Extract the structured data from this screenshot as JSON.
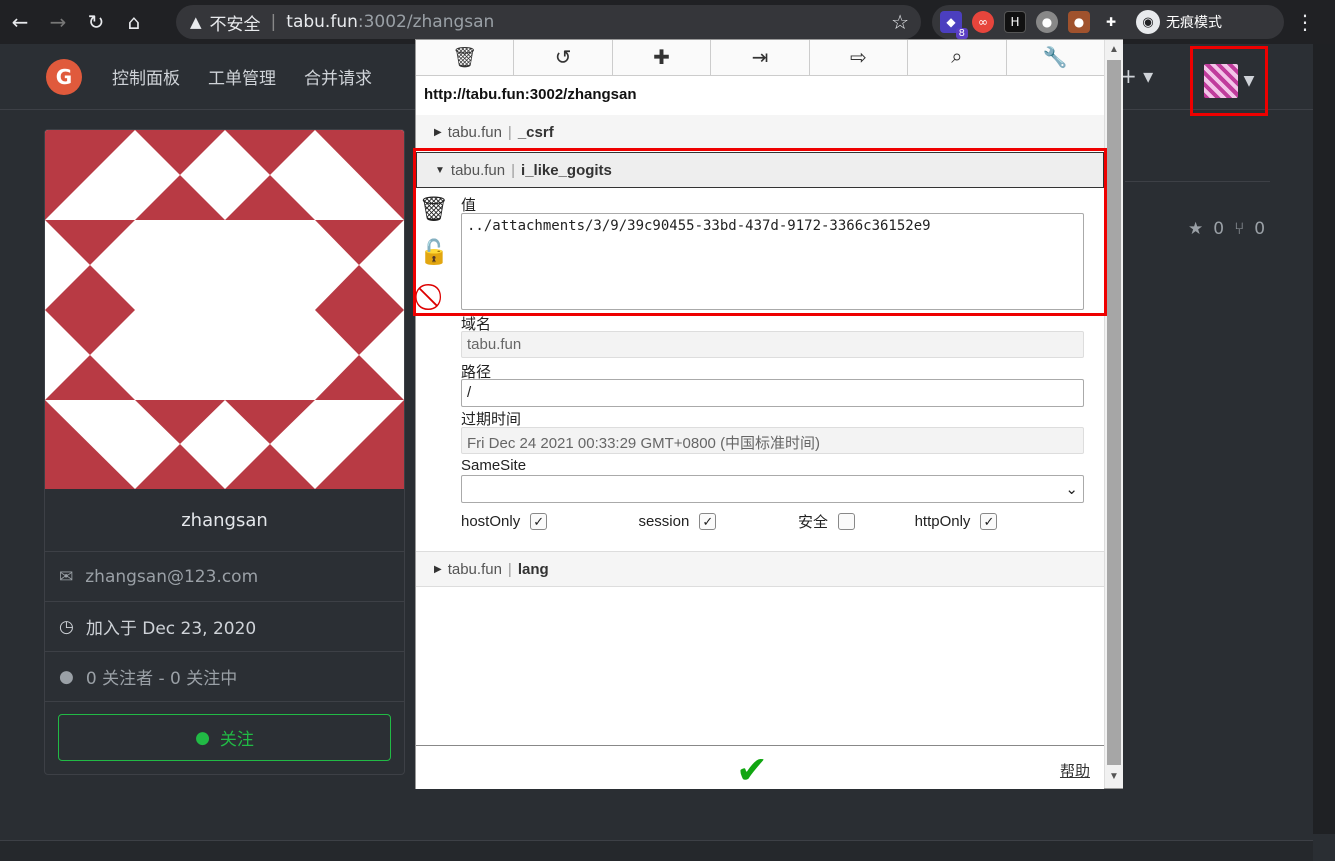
{
  "browser": {
    "address_warning": "不安全",
    "url_host": "tabu.fun",
    "url_rest": ":3002/zhangsan",
    "ext_badge": "8",
    "incognito_label": "无痕模式"
  },
  "site": {
    "nav": [
      "控制面板",
      "工单管理",
      "合并请求"
    ],
    "plus": "+"
  },
  "profile": {
    "username": "zhangsan",
    "email": "zhangsan@123.com",
    "joined": "加入于 Dec 23, 2020",
    "followers": "0 关注者 - 0 关注中",
    "follow_button": "关注",
    "stars": "0",
    "forks": "0"
  },
  "cookie_editor": {
    "url": "http://tabu.fun:3002/zhangsan",
    "cookies": [
      {
        "domain": "tabu.fun",
        "name": "_csrf"
      },
      {
        "domain": "tabu.fun",
        "name": "i_like_gogits"
      },
      {
        "domain": "tabu.fun",
        "name": "lang"
      }
    ],
    "labels": {
      "value": "值",
      "domain": "域名",
      "path": "路径",
      "expires": "过期时间",
      "samesite": "SameSite",
      "hostonly": "hostOnly",
      "session": "session",
      "secure": "安全",
      "httponly": "httpOnly"
    },
    "values": {
      "value": "../attachments/3/9/39c90455-33bd-437d-9172-3366c36152e9",
      "domain": "tabu.fun",
      "path": "/",
      "expires": "Fri Dec 24 2021 00:33:29 GMT+0800 (中国标准时间)",
      "samesite": ""
    },
    "help": "帮助"
  },
  "colors": {
    "follow_green": "#21ba45",
    "highlight_red": "#ee0000",
    "identicon_red": "#b83a44"
  }
}
